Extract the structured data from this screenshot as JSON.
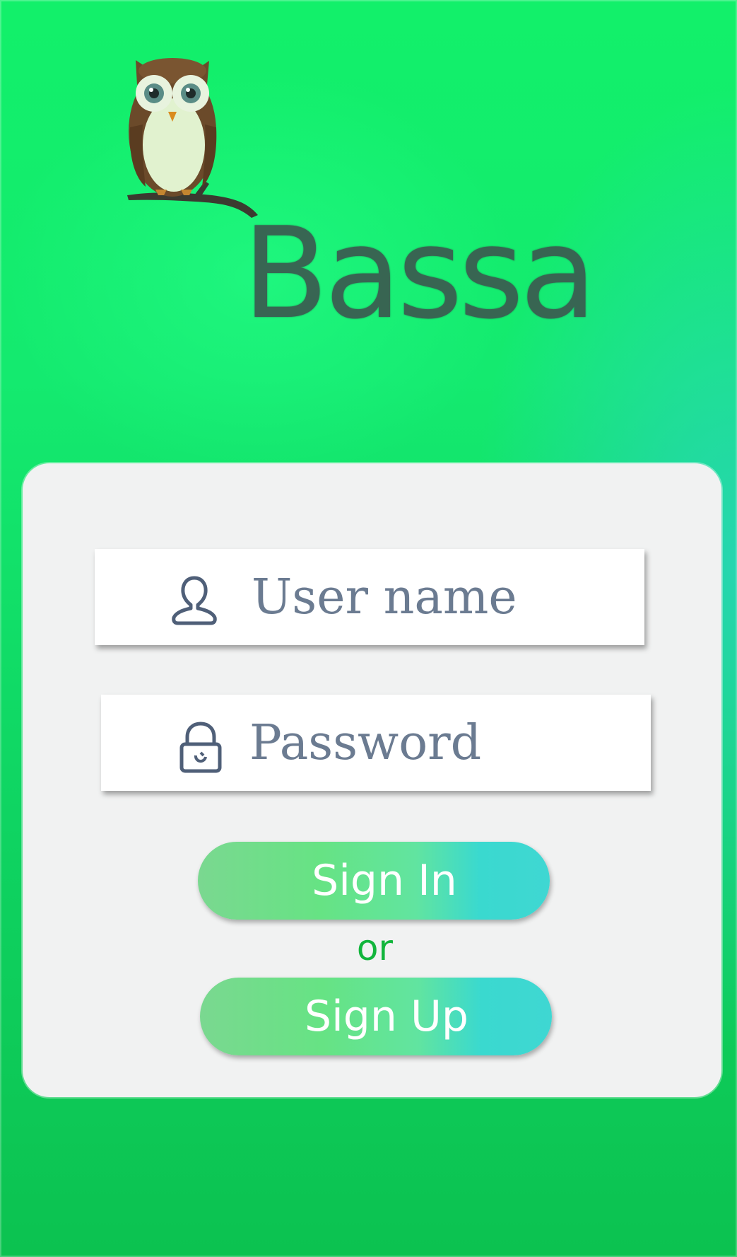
{
  "app": {
    "logo_text": "Bassa"
  },
  "login_form": {
    "username": {
      "placeholder": "User name",
      "value": "",
      "icon": "user-icon"
    },
    "password": {
      "placeholder": "Password",
      "value": "",
      "icon": "lock-icon"
    },
    "sign_in_label": "Sign In",
    "separator_label": "or",
    "sign_up_label": "Sign Up"
  },
  "colors": {
    "background_green": "#12f06a",
    "background_teal": "#2dd2c8",
    "card_background": "#f1f2f2",
    "button_gradient_start": "#7ad890",
    "button_gradient_end": "#3fd7d2",
    "placeholder_text": "#6b7b91",
    "separator_text": "#12b53c",
    "logo_text": "#3b5a50"
  }
}
